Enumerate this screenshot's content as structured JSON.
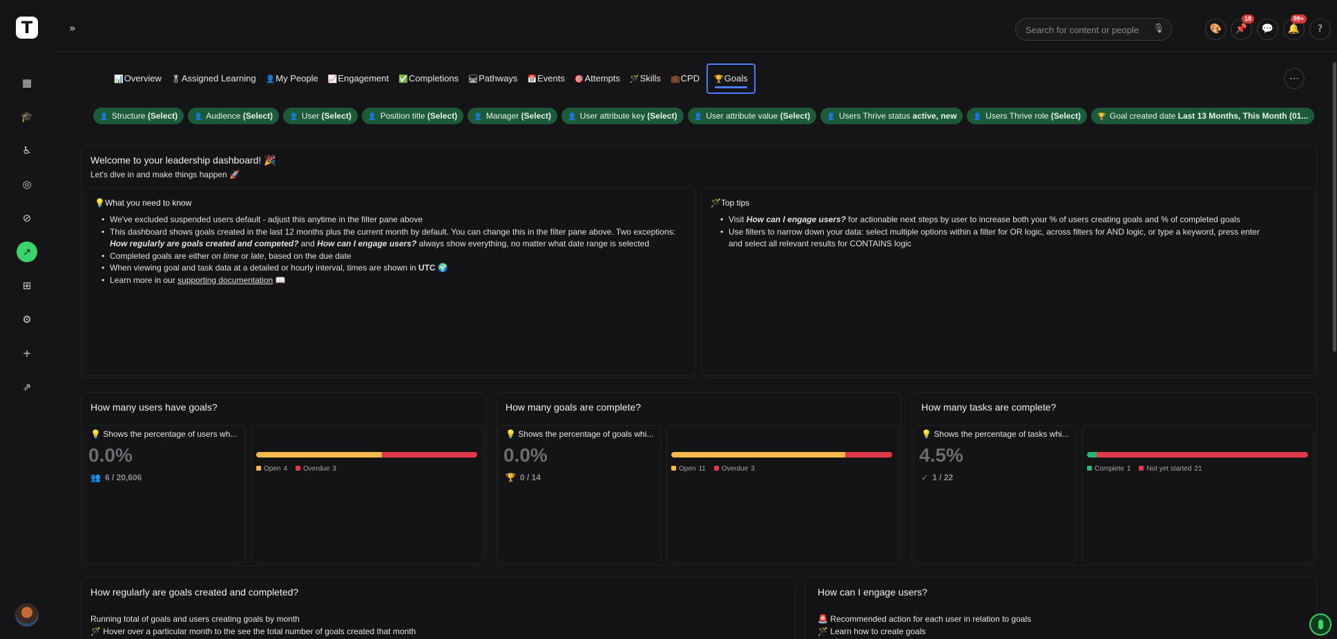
{
  "app": {
    "logo_letter": "T",
    "rail_icons": [
      "dashboard-icon",
      "graduation-cap-icon",
      "learning-path-icon",
      "target-icon",
      "compass-icon",
      "analytics-icon",
      "table-icon",
      "settings-icon",
      "plus-icon",
      "external-link-icon"
    ],
    "active_rail": "analytics-icon"
  },
  "topbar": {
    "expand_glyph": "»",
    "search_placeholder": "Search for content or people",
    "pin_badge": "18",
    "notifications_badge": "99+"
  },
  "tabs": [
    {
      "icon": "📊",
      "label": "Overview"
    },
    {
      "icon": "🎖",
      "label": "Assigned Learning"
    },
    {
      "icon": "👤",
      "label": "My People"
    },
    {
      "icon": "📈",
      "label": "Engagement"
    },
    {
      "icon": "✅",
      "label": "Completions"
    },
    {
      "icon": "🛤",
      "label": "Pathways"
    },
    {
      "icon": "📅",
      "label": "Events"
    },
    {
      "icon": "🎯",
      "label": "Attempts"
    },
    {
      "icon": "🪄",
      "label": "Skills"
    },
    {
      "icon": "💼",
      "label": "CPD"
    },
    {
      "icon": "🏆",
      "label": "Goals"
    }
  ],
  "filters": [
    {
      "icon": "👤",
      "label": "Structure",
      "value": "(Select)"
    },
    {
      "icon": "👤",
      "label": "Audience",
      "value": "(Select)"
    },
    {
      "icon": "👤",
      "label": "User",
      "value": "(Select)"
    },
    {
      "icon": "👤",
      "label": "Position title",
      "value": "(Select)"
    },
    {
      "icon": "👤",
      "label": "Manager",
      "value": "(Select)"
    },
    {
      "icon": "👤",
      "label": "User attribute key",
      "value": "(Select)"
    },
    {
      "icon": "👤",
      "label": "User attribute value",
      "value": "(Select)"
    },
    {
      "icon": "👤",
      "label": "Users Thrive status",
      "value": "active, new"
    },
    {
      "icon": "👤",
      "label": "Users Thrive role",
      "value": "(Select)"
    },
    {
      "icon": "🏆",
      "label": "Goal created date",
      "value": "Last 13 Months, This Month (01..."
    }
  ],
  "welcome": {
    "title": "Welcome to your leadership dashboard! 🎉",
    "subtitle": "Let's dive in and make things happen 🚀",
    "know_title": "💡What you need to know",
    "know_1": "We've excluded suspended users default - adjust this anytime in the filter pane above",
    "know_2a": "This dashboard shows goals created in the last 12 months plus the current month by default. You can change this in the filter pane above. Two exceptions:",
    "know_2b": "How regularly are goals created and competed?",
    "know_2c": " and ",
    "know_2d": "How can I engage users?",
    "know_2e": " always show everything, no matter what date range is selected",
    "know_3a": "Completed goals are either ",
    "know_3b": "on time",
    "know_3c": " or ",
    "know_3d": "late",
    "know_3e": ", based on the due date",
    "know_4a": "When viewing goal and task data at a detailed or hourly interval, times are shown in ",
    "know_4b": "UTC",
    "know_4c": " 🌍",
    "know_5a": "Learn more in our ",
    "know_5b": "supporting documentation",
    "know_5c": " 📖",
    "tips_title": "🪄Top tips",
    "tip_1a": "Visit ",
    "tip_1b": "How can I engage users?",
    "tip_1c": " for actionable next steps by user to increase both your % of users creating goals and % of completed goals",
    "tip_2": "Use filters to narrow down your data: select multiple options within a filter for OR logic, across filters for AND logic, or type a keyword, press enter and select all relevant results for CONTAINS logic"
  },
  "kpis": [
    {
      "title": "How many users have goals?",
      "hint": "💡 Shows the percentage of users wh...",
      "value": "0.0%",
      "count_icon": "users-icon",
      "count_glyph": "👥",
      "count": "6 / 20,606",
      "legend": [
        {
          "label": "Open",
          "value": "4",
          "color": "#f5b94a"
        },
        {
          "label": "Overdue",
          "value": "3",
          "color": "#e0394a"
        }
      ],
      "bar": [
        0.57,
        0.43
      ]
    },
    {
      "title": "How many goals are complete?",
      "hint": "💡 Shows the percentage of goals whi...",
      "value": "0.0%",
      "count_icon": "trophy-icon",
      "count_glyph": "🏆",
      "count": "0 / 14",
      "legend": [
        {
          "label": "Open",
          "value": "11",
          "color": "#f5b94a"
        },
        {
          "label": "Overdue",
          "value": "3",
          "color": "#e0394a"
        }
      ],
      "bar": [
        0.786,
        0.214
      ]
    },
    {
      "title": "How many tasks are complete?",
      "hint": "💡 Shows the percentage of tasks whi...",
      "value": "4.5%",
      "count_icon": "check-circle-icon",
      "count_glyph": "✓",
      "count": "1 / 22",
      "legend": [
        {
          "label": "Complete",
          "value": "1",
          "color": "#2bb673"
        },
        {
          "label": "Not yet started",
          "value": "21",
          "color": "#e0394a"
        }
      ],
      "bar": [
        0.045,
        0.955
      ]
    }
  ],
  "bottom": {
    "left_title": "How regularly are goals created and completed?",
    "left_line1": "Running total of goals and users creating goals by month",
    "left_line2": "🪄 Hover over a particular month to the see the total number of goals created that month",
    "right_title": "How can I engage users?",
    "right_line1": "🚨 Recommended action for each user in relation to goals",
    "right_line2": "🪄 Learn how to create goals"
  }
}
